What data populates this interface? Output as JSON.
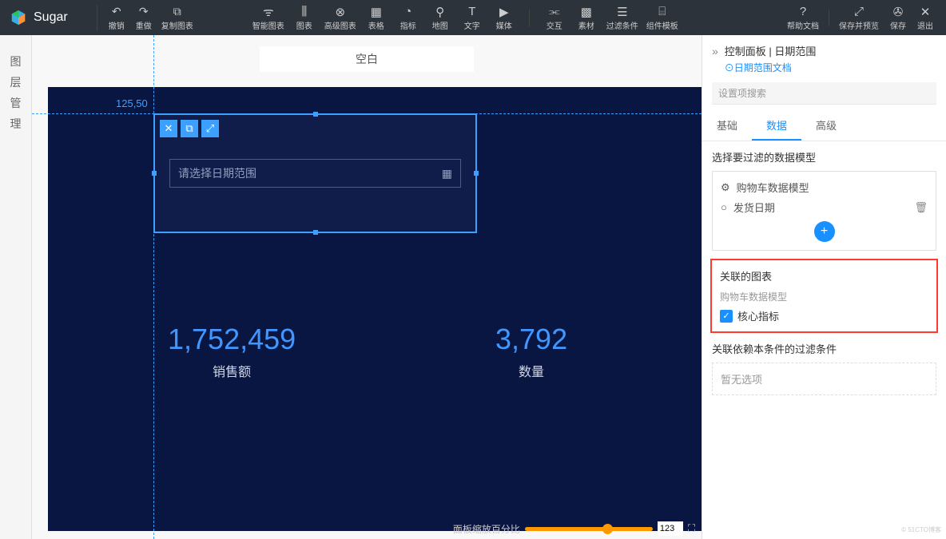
{
  "app": {
    "name": "Sugar"
  },
  "topActions": {
    "undo": "撤销",
    "redo": "重做",
    "copyChart": "复制图表"
  },
  "tools": {
    "smartChart": "智能图表",
    "chart": "图表",
    "advChart": "高级图表",
    "table": "表格",
    "indicator": "指标",
    "map": "地图",
    "text": "文字",
    "media": "媒体",
    "interact": "交互",
    "material": "素材",
    "filter": "过滤条件",
    "compTpl": "组件模板"
  },
  "rightActions": {
    "helpDoc": "帮助文档",
    "savePreview": "保存并预览",
    "save": "保存",
    "exit": "退出"
  },
  "leftStrip": "图层管理",
  "canvas": {
    "tabTitle": "空白",
    "coord": "125,50",
    "datePlaceholder": "请选择日期范围",
    "metric1": {
      "value": "1,752,459",
      "label": "销售额"
    },
    "metric2": {
      "value": "3,792",
      "label": "数量"
    },
    "zoomLabel": "面板缩放百分比",
    "zoomValue": "123"
  },
  "rightPanel": {
    "breadcrumb": "控制面板 | 日期范围",
    "docLink": "⊙日期范围文档",
    "searchPlaceholder": "设置项搜索",
    "tabs": {
      "basic": "基础",
      "data": "数据",
      "advanced": "高级"
    },
    "section1": {
      "title": "选择要过滤的数据模型",
      "model": "购物车数据模型",
      "field": "发货日期"
    },
    "section2": {
      "title": "关联的图表",
      "subtitle": "购物车数据模型",
      "item": "核心指标"
    },
    "section3": {
      "title": "关联依赖本条件的过滤条件",
      "empty": "暂无选项"
    }
  }
}
